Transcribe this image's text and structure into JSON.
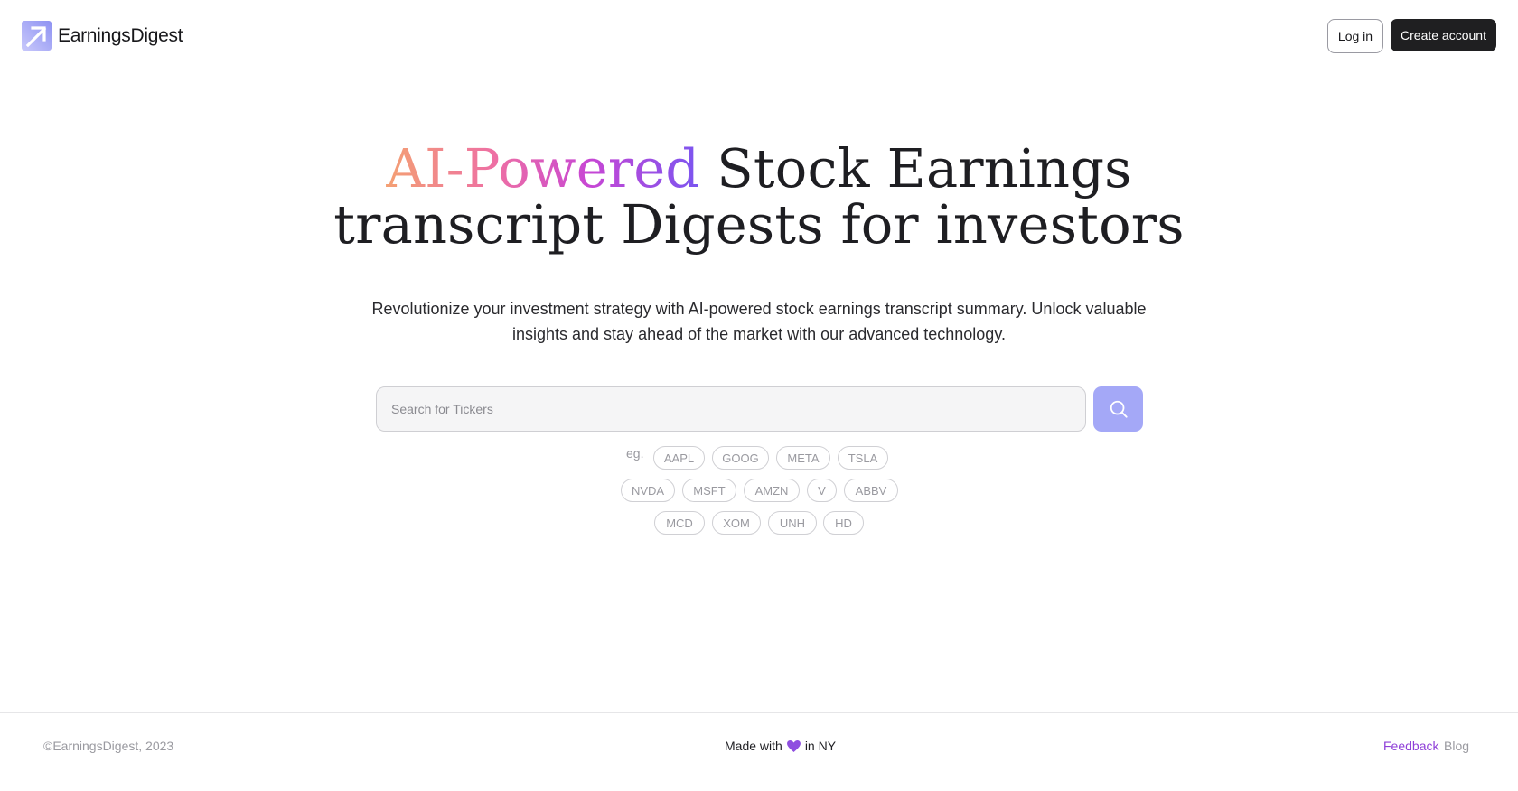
{
  "brand": {
    "name": "EarningsDigest",
    "logo_icon": "arrow-up-right-logo-icon"
  },
  "header": {
    "login_label": "Log in",
    "create_account_label": "Create account"
  },
  "hero": {
    "title_highlight": "AI-Powered",
    "title_line1_rest": " Stock Earnings",
    "title_line2": "transcript Digests for investors",
    "subtitle": "Revolutionize your investment strategy with AI-powered stock earnings transcript summary. Unlock valuable insights and stay ahead of the market with our advanced technology."
  },
  "search": {
    "placeholder": "Search for Tickers",
    "value": "",
    "button_icon": "search-icon",
    "example_label": "eg.",
    "tickers_row1": [
      "AAPL",
      "GOOG",
      "META",
      "TSLA"
    ],
    "tickers_row2": [
      "NVDA",
      "MSFT",
      "AMZN",
      "V",
      "ABBV"
    ],
    "tickers_row3": [
      "MCD",
      "XOM",
      "UNH",
      "HD"
    ]
  },
  "footer": {
    "copyright": "©EarningsDigest, 2023",
    "made_with_prefix": "Made with",
    "made_with_suffix": "in NY",
    "heart_icon": "heart-icon",
    "feedback_label": "Feedback",
    "blog_label": "Blog"
  },
  "colors": {
    "primary_button": "#1f1f21",
    "search_button": "#a4a8f7",
    "accent_purple": "#8f3fd8",
    "gradient": [
      "#f4a073",
      "#ee6fa4",
      "#c746d4",
      "#7b55f0"
    ]
  }
}
